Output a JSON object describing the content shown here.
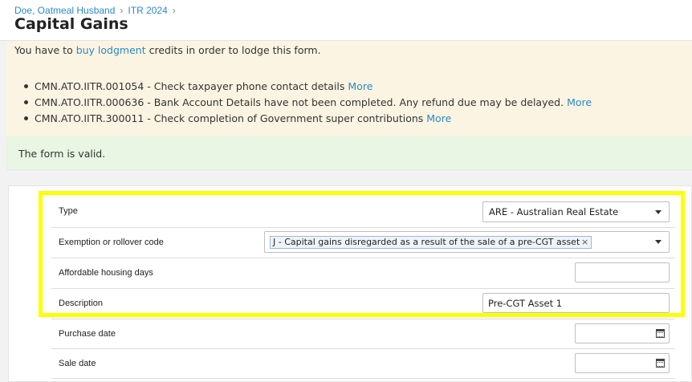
{
  "breadcrumb": {
    "client": "Doe, Oatmeal Husband",
    "return": "ITR 2024"
  },
  "page_title": "Capital Gains",
  "alert": {
    "prefix": "You have to ",
    "link": "buy lodgment",
    "suffix": " credits in order to lodge this form.",
    "messages": [
      {
        "text": "CMN.ATO.IITR.001054 - Check taxpayer phone contact details ",
        "more": "More"
      },
      {
        "text": "CMN.ATO.IITR.000636 - Bank Account Details have not been completed. Any refund due may be delayed. ",
        "more": "More"
      },
      {
        "text": "CMN.ATO.IITR.300011 - Check completion of Government super contributions ",
        "more": "More"
      }
    ]
  },
  "valid_message": "The form is valid.",
  "form": {
    "type": {
      "label": "Type",
      "value": "ARE - Australian Real Estate"
    },
    "exemption": {
      "label": "Exemption or rollover code",
      "tag": "J - Capital gains disregarded as a result of the sale of a pre-CGT asset",
      "remove": "×"
    },
    "affordable": {
      "label": "Affordable housing days",
      "value": ""
    },
    "description": {
      "label": "Description",
      "value": "Pre-CGT Asset 1"
    },
    "purchase_date": {
      "label": "Purchase date",
      "value": ""
    },
    "sale_date": {
      "label": "Sale date",
      "value": ""
    }
  },
  "colors": {
    "link": "#2a8ac4",
    "warning_bg": "#fcf4e2",
    "success_bg": "#e8f6e3",
    "highlight": "#ffff00"
  }
}
